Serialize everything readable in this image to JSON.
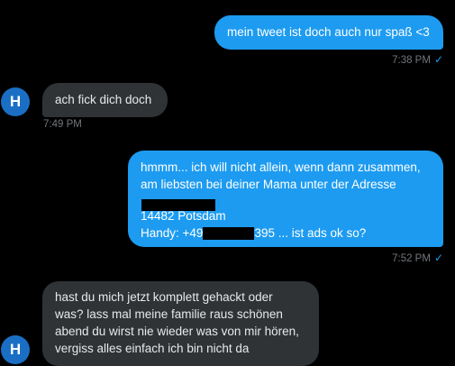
{
  "conversation": {
    "messages": [
      {
        "sender": "me",
        "text": "mein tweet ist doch auch nur spaß <3",
        "time": "7:38 PM",
        "status": "seen"
      },
      {
        "sender": "H",
        "text": "ach fick dich doch",
        "time": "7:49 PM"
      },
      {
        "sender": "me",
        "lines": [
          "hmmm... ich will nicht allein, wenn dann zusammen,",
          "am liebsten bei deiner Mama unter der Adresse",
          "[redacted]",
          "14482 Potsdam",
          "Handy: +49",
          "395 ... ist ads ok so?"
        ],
        "time": "7:52 PM",
        "status": "seen"
      },
      {
        "sender": "H",
        "lines": [
          "hast du mich jetzt komplett gehackt oder",
          "was? lass mal meine familie raus schönen",
          "abend du wirst nie wieder was von mir hören,",
          "vergiss alles einfach ich bin nicht da"
        ]
      }
    ],
    "avatar_initial": "H"
  },
  "icons": {
    "seen": "check-icon"
  },
  "colors": {
    "background": "#000000",
    "outgoing_bubble": "#1d9bf0",
    "incoming_bubble": "#2f3336",
    "timestamp": "#71767b",
    "avatar": "#1a6fc4"
  }
}
